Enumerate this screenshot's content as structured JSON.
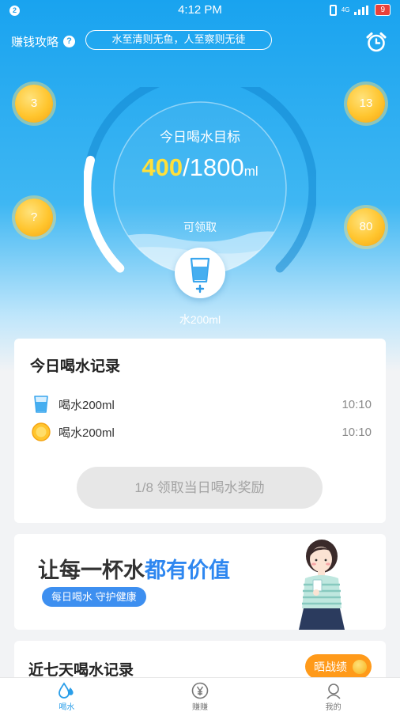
{
  "statusbar": {
    "badge": "2",
    "time": "4:12 PM",
    "network": "4G",
    "battery": "9"
  },
  "header": {
    "tips_label": "赚钱攻略",
    "help_icon": "question-icon",
    "marquee": "水至清则无鱼，人至察则无徒",
    "alarm_icon": "alarm-clock-icon"
  },
  "coins": [
    {
      "value": "3"
    },
    {
      "value": "?"
    },
    {
      "value": "13"
    },
    {
      "value": "80"
    }
  ],
  "goal": {
    "title": "今日喝水目标",
    "current": "400",
    "separator": "/",
    "target": "1800",
    "unit": "ml",
    "progress": 0.22,
    "claim_hint": "可领取",
    "add_button_label": "水200ml"
  },
  "today_records": {
    "title": "今日喝水记录",
    "items": [
      {
        "icon": "water-cup-icon",
        "text": "喝水200ml",
        "time": "10:10"
      },
      {
        "icon": "gold-coin-icon",
        "text": "喝水200ml",
        "time": "10:10"
      }
    ],
    "claim_button": "1/8 领取当日喝水奖励"
  },
  "banner": {
    "title_plain": "让每一杯水",
    "title_highlight": "都有价值",
    "pill": "每日喝水 守护健康"
  },
  "week_records": {
    "title": "近七天喝水记录",
    "share_button": "晒战绩"
  },
  "tabbar": [
    {
      "label": "喝水",
      "icon": "water-drop-icon",
      "active": true
    },
    {
      "label": "赚赚",
      "icon": "yuan-coin-icon",
      "active": false
    },
    {
      "label": "我的",
      "icon": "profile-icon",
      "active": false
    }
  ],
  "colors": {
    "primary": "#1aa2ef",
    "highlight": "#ffe03a",
    "accent": "#2e87f0",
    "orange": "#ff9a1a"
  }
}
